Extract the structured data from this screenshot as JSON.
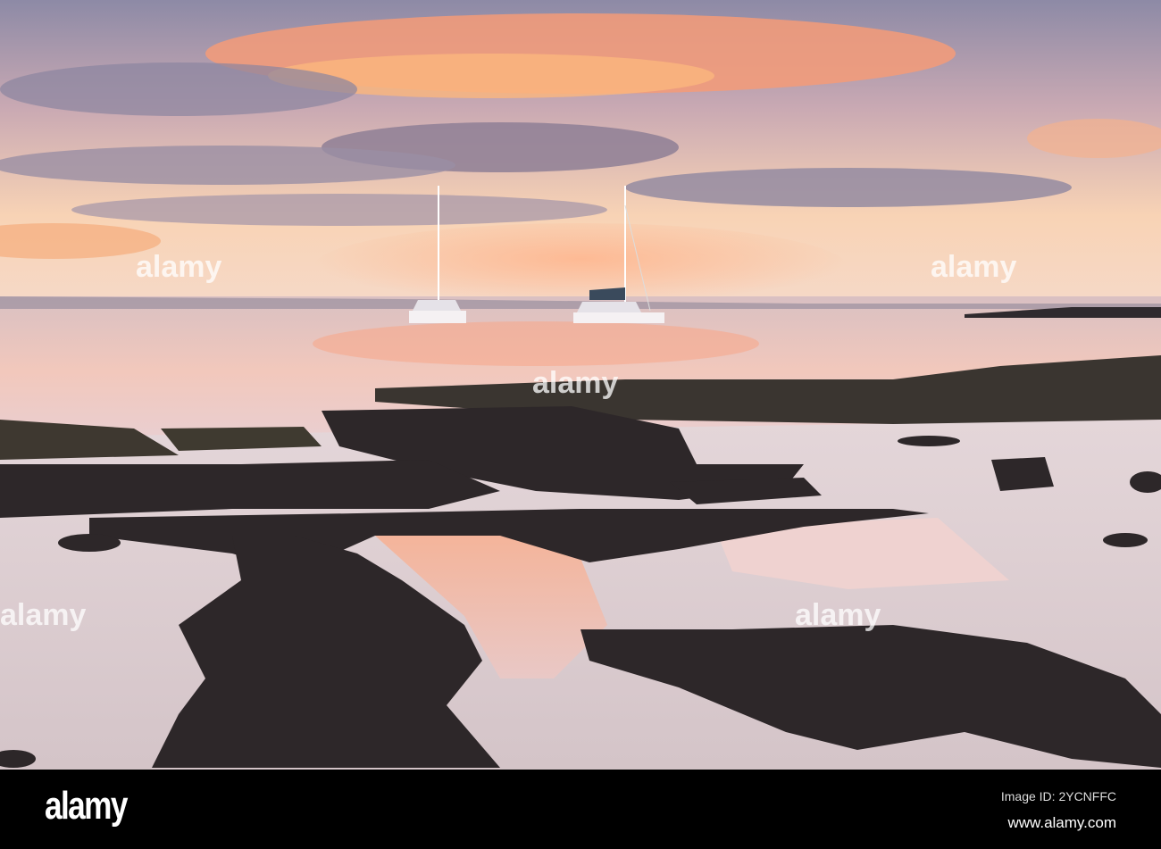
{
  "footer": {
    "logo": "alamy",
    "image_id": "Image ID: 2YCNFFC",
    "website": "www.alamy.com"
  },
  "watermark": "alamy",
  "colors": {
    "sky_top": "#7f7a9a",
    "sunset_orange": "#f4a37a",
    "horizon_glow": "#fbd9b8",
    "sea": "#e9c4c0",
    "rock": "#2b2628",
    "sand": "#ddd0d3"
  }
}
